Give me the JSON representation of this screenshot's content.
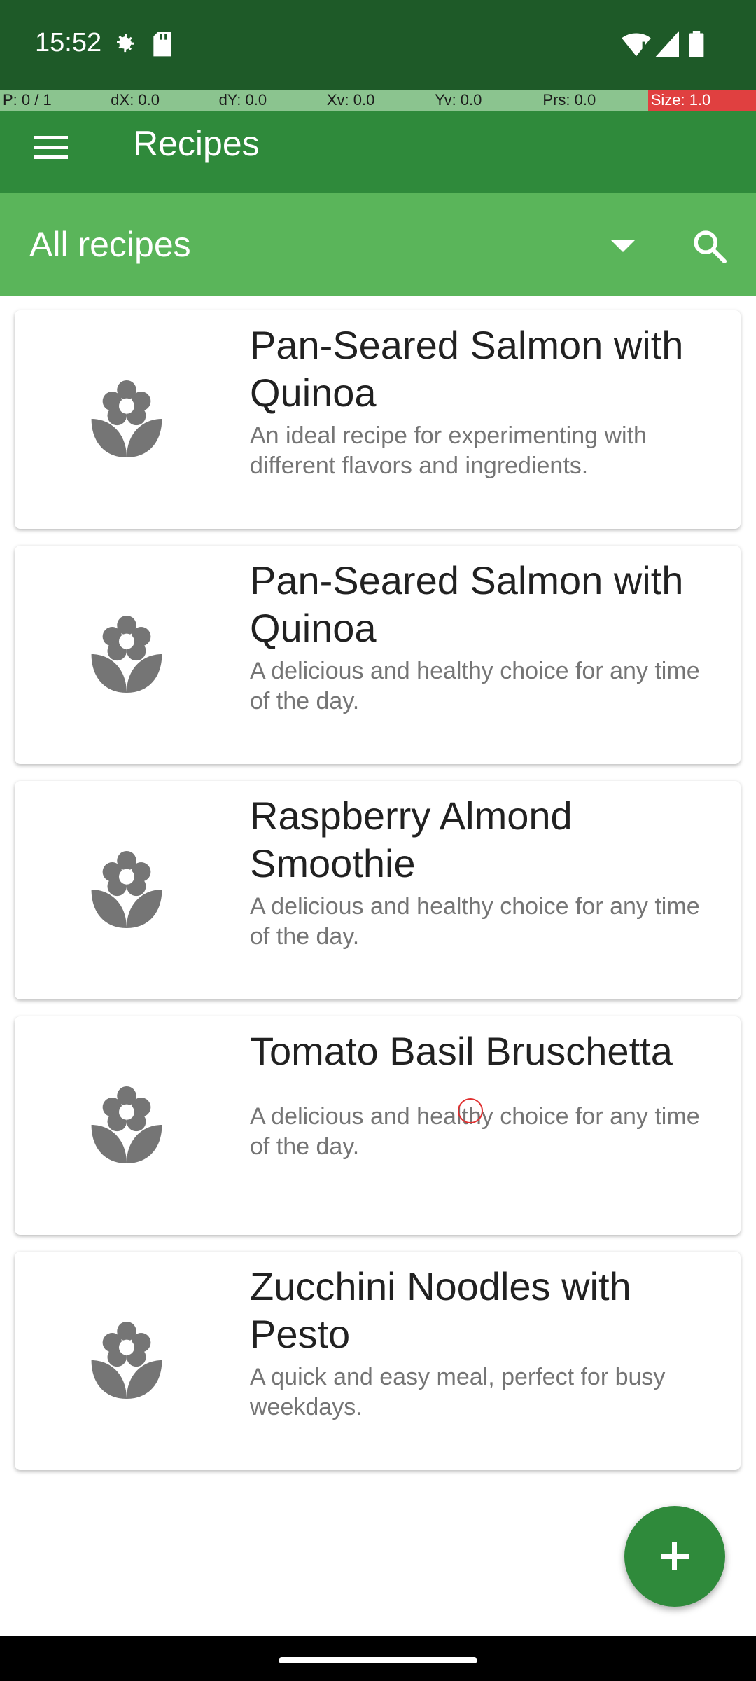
{
  "status_bar": {
    "time": "15:52"
  },
  "debug_bar": {
    "cells": [
      "P: 0 / 1",
      "dX: 0.0",
      "dY: 0.0",
      "Xv: 0.0",
      "Yv: 0.0",
      "Prs: 0.0",
      "Size: 1.0"
    ]
  },
  "app_bar": {
    "title": "Recipes",
    "menu_icon": "hamburger-menu-icon"
  },
  "filter": {
    "selected": "All recipes",
    "dropdown_icon": "dropdown-arrow-icon",
    "search_icon": "search-icon"
  },
  "recipes": [
    {
      "title": "Pan-Seared Salmon with Quinoa",
      "description": "An ideal recipe for experimenting with different flavors and ingredients."
    },
    {
      "title": "Pan-Seared Salmon with Quinoa",
      "description": "A delicious and healthy choice for any time of the day."
    },
    {
      "title": "Raspberry Almond Smoothie",
      "description": "A delicious and healthy choice for any time of the day."
    },
    {
      "title": "Tomato Basil Bruschetta",
      "description": "A delicious and healthy choice for any time of the day."
    },
    {
      "title": "Zucchini Noodles with Pesto",
      "description": "A quick and easy meal, perfect for busy weekdays."
    }
  ],
  "fab": {
    "icon": "plus-icon"
  },
  "colors": {
    "status_bar": "#1e5a28",
    "app_bar": "#2f8a3b",
    "filter_bar": "#5ab55a",
    "icon_gray": "#757575"
  }
}
